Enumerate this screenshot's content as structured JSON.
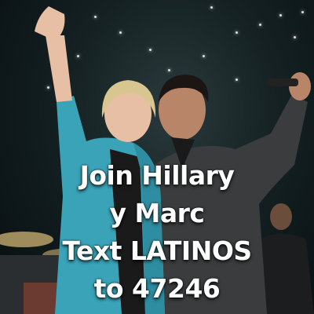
{
  "caption": {
    "line1": "Join Hillary",
    "line2": "y Marc",
    "line3": "Text LATINOS",
    "line4": "to 47246"
  },
  "colors": {
    "jacket_teal": "#3aa3b8",
    "shirt_black": "#1a1a1a",
    "caption_text": "#ffffff"
  }
}
